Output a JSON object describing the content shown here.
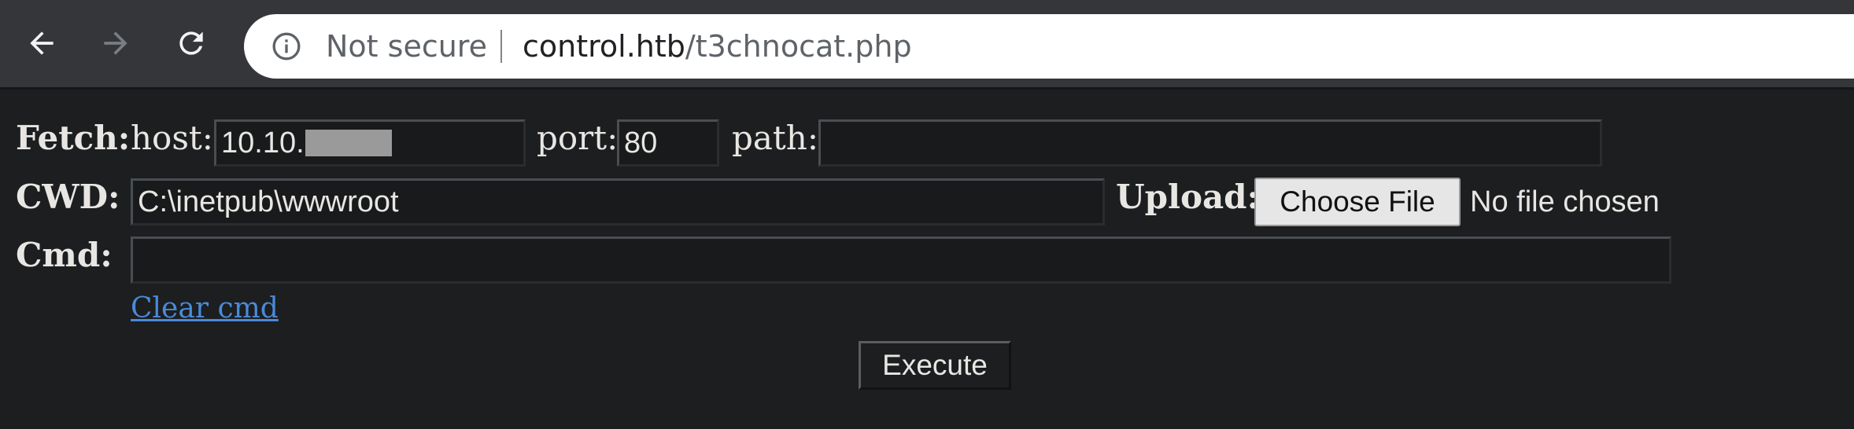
{
  "browser": {
    "security_label": "Not secure",
    "url_host": "control.htb",
    "url_path": "/t3chnocat.php",
    "icons": [
      "back-arrow-icon",
      "forward-arrow-icon",
      "reload-icon",
      "info-icon"
    ]
  },
  "form": {
    "fetch_label": "Fetch:",
    "host_label": "host:",
    "host_value": "10.10.",
    "port_label": "port:",
    "port_value": "80",
    "path_label": "path:",
    "path_value": "",
    "cwd_label": "CWD:",
    "cwd_value": "C:\\inetpub\\wwwroot",
    "upload_label": "Upload:",
    "choose_file_label": "Choose File",
    "no_file_text": "No file chosen",
    "cmd_label": "Cmd:",
    "cmd_value": "",
    "clear_cmd_label": "Clear cmd",
    "execute_label": "Execute"
  },
  "colors": {
    "page_background": "#1c1e20",
    "toolbar_background": "#35363a",
    "omnibox_background": "#ffffff",
    "link": "#4a8ad8",
    "text": "#e8e6e3"
  }
}
